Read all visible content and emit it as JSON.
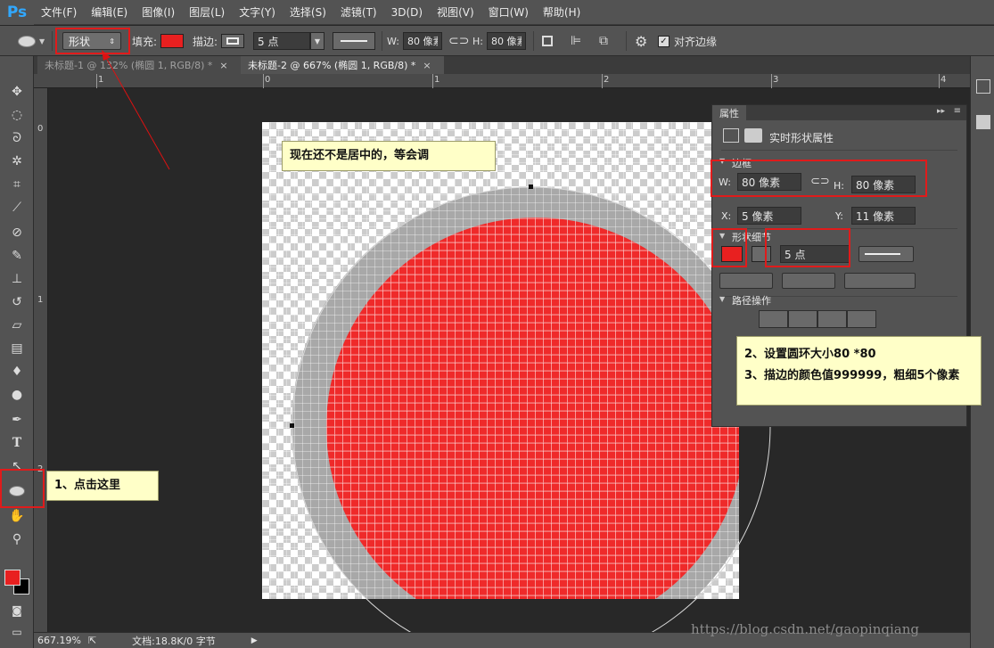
{
  "app": {
    "logo": "Ps"
  },
  "menu": [
    "文件(F)",
    "编辑(E)",
    "图像(I)",
    "图层(L)",
    "文字(Y)",
    "选择(S)",
    "滤镜(T)",
    "3D(D)",
    "视图(V)",
    "窗口(W)",
    "帮助(H)"
  ],
  "options": {
    "mode": "形状",
    "fill_label": "填充:",
    "stroke_label": "描边:",
    "stroke_width": "5 点",
    "w_label": "W:",
    "w_value": "80 像素",
    "h_label": "H:",
    "h_value": "80 像素",
    "align_edges": "对齐边缘",
    "fill_color": "#e82020"
  },
  "tabs": [
    {
      "title": "未标题-1 @ 132% (椭圆 1, RGB/8) *",
      "close": "×"
    },
    {
      "title": "未标题-2 @ 667% (椭圆 1, RGB/8) *",
      "close": "×"
    }
  ],
  "ruler": {
    "h": [
      "1",
      "0",
      "1",
      "2",
      "3",
      "4"
    ],
    "v": [
      "0",
      "1",
      "2"
    ]
  },
  "panel": {
    "tab": "属性",
    "heading": "实时形状属性",
    "section_bounds": "边框",
    "w_label": "W:",
    "w_value": "80 像素",
    "h_label": "H:",
    "h_value": "80 像素",
    "x_label": "X:",
    "x_value": "5 像素",
    "y_label": "Y:",
    "y_value": "11 像素",
    "section_shape": "形状细节",
    "stroke_width": "5 点",
    "section_path": "路径操作"
  },
  "status": {
    "zoom": "667.19%",
    "doc": "文档:18.8K/0 字节"
  },
  "annotations": {
    "note1": "现在还不是居中的，等会调",
    "note2_line1": "2、设置圆环大小80 *80",
    "note2_line2": "3、描边的颜色值999999，粗细5个像素",
    "note3": "1、点击这里"
  },
  "watermark": "https://blog.csdn.net/gaopinqiang",
  "colors": {
    "accent_red": "#e01b1b",
    "shape_fill": "#ef2a2a",
    "ring": "#a8a8a8"
  }
}
